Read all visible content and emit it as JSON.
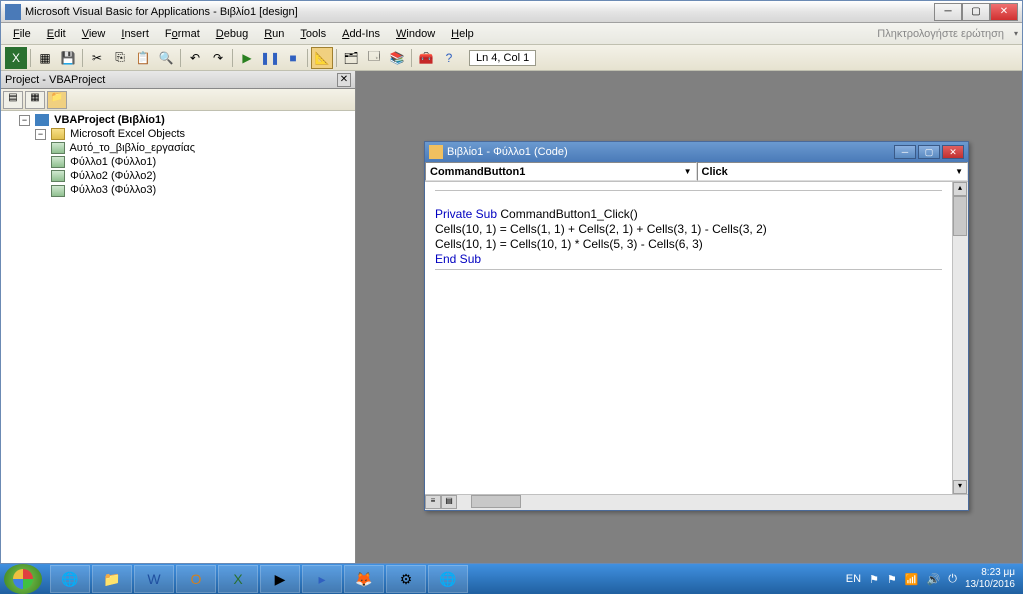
{
  "title_bar": {
    "title": "Microsoft Visual Basic for Applications - Βιβλίο1 [design]"
  },
  "menu": {
    "file": "File",
    "edit": "Edit",
    "view": "View",
    "insert": "Insert",
    "format": "Format",
    "debug": "Debug",
    "run": "Run",
    "tools": "Tools",
    "addins": "Add-Ins",
    "window": "Window",
    "help": "Help",
    "help_prompt": "Πληκτρολογήστε ερώτηση"
  },
  "toolbar": {
    "status": "Ln 4, Col 1"
  },
  "project_panel": {
    "title": "Project - VBAProject",
    "root": "VBAProject (Βιβλίο1)",
    "folder": "Microsoft Excel Objects",
    "items": [
      "Αυτό_το_βιβλίο_εργασίας",
      "Φύλλο1 (Φύλλο1)",
      "Φύλλο2 (Φύλλο2)",
      "Φύλλο3 (Φύλλο3)"
    ]
  },
  "code_window": {
    "title": "Βιβλίο1 - Φύλλο1 (Code)",
    "dd_object": "CommandButton1",
    "dd_proc": "Click",
    "code": {
      "l1a": "Private Sub",
      "l1b": " CommandButton1_Click()",
      "l2": "Cells(10, 1) = Cells(1, 1) + Cells(2, 1) + Cells(3, 1) - Cells(3, 2)",
      "l3": "Cells(10, 1) = Cells(10, 1) * Cells(5, 3) - Cells(6, 3)",
      "l4": "End Sub"
    }
  },
  "taskbar": {
    "lang": "EN",
    "time": "8:23 μμ",
    "date": "13/10/2016"
  }
}
